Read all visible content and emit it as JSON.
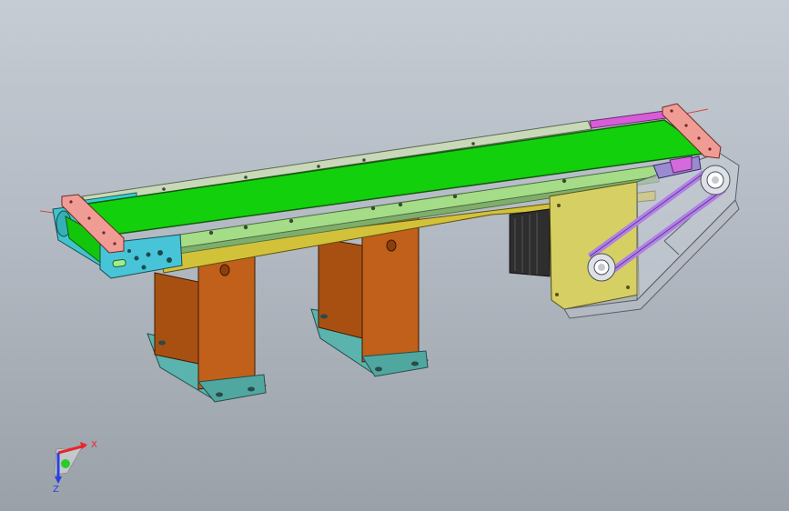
{
  "viewport": {
    "background_top": "#c5ccd4",
    "background_bottom": "#9aa1a8"
  },
  "triad": {
    "x_label": "X",
    "z_label": "Z",
    "x_color": "#e8262a",
    "y_color": "#2bcb2b",
    "z_color": "#2c3fe0"
  },
  "model": {
    "belt_color": "#10d10a",
    "side_rail_color": "#a6e08a",
    "frame_color": "#d8c93a",
    "leg_color": "#b55a14",
    "foot_color": "#62b8b0",
    "end_block_color": "#f0a09a",
    "drive_belt_color": "#b785e8",
    "motor_color": "#333333"
  }
}
